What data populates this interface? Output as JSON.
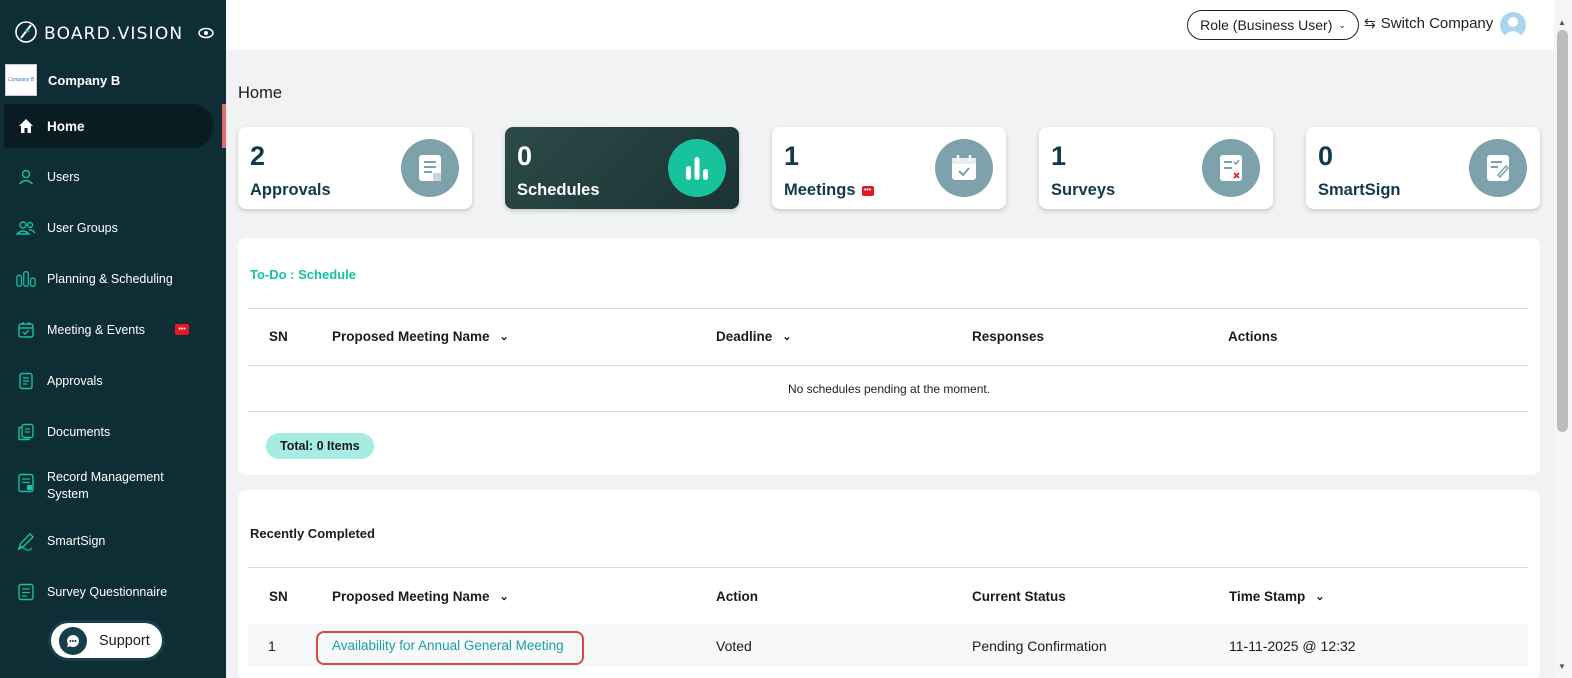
{
  "brand": {
    "name": "BOARD.VISION"
  },
  "company": {
    "name": "Company B",
    "logo_text": "Company B"
  },
  "sidebar": {
    "items": [
      {
        "label": "Home",
        "icon": "home-icon",
        "active": true
      },
      {
        "label": "Users",
        "icon": "user-icon"
      },
      {
        "label": "User Groups",
        "icon": "user-groups-icon"
      },
      {
        "label": "Planning & Scheduling",
        "icon": "planning-icon"
      },
      {
        "label": "Meeting & Events",
        "icon": "calendar-check-icon",
        "badge": "chat"
      },
      {
        "label": "Approvals",
        "icon": "approvals-icon"
      },
      {
        "label": "Documents",
        "icon": "documents-icon"
      },
      {
        "label": "Record Management",
        "label2": "System",
        "icon": "record-icon"
      },
      {
        "label": "SmartSign",
        "icon": "smartsign-icon"
      },
      {
        "label": "Survey Questionnaire",
        "icon": "survey-icon"
      }
    ],
    "support_label": "Support"
  },
  "topbar": {
    "role_label": "Role (Business User)",
    "switch_label": "Switch Company"
  },
  "page": {
    "title": "Home"
  },
  "cards": [
    {
      "count": "2",
      "label": "Approvals",
      "icon": "approvals-doc-icon"
    },
    {
      "count": "0",
      "label": "Schedules",
      "icon": "bar-chart-icon",
      "active": true
    },
    {
      "count": "1",
      "label": "Meetings",
      "icon": "calendar-icon",
      "badge": true
    },
    {
      "count": "1",
      "label": "Surveys",
      "icon": "survey-doc-icon"
    },
    {
      "count": "0",
      "label": "SmartSign",
      "icon": "sign-doc-icon"
    }
  ],
  "todo": {
    "title": "To-Do : Schedule",
    "columns": [
      "SN",
      "Proposed Meeting Name",
      "Deadline",
      "Responses",
      "Actions"
    ],
    "empty_message": "No schedules pending at the moment.",
    "total_label": "Total: 0 Items"
  },
  "recent": {
    "title": "Recently Completed",
    "columns": [
      "SN",
      "Proposed Meeting Name",
      "Action",
      "Current Status",
      "Time Stamp"
    ],
    "rows": [
      {
        "sn": "1",
        "name": "Availability for Annual General Meeting",
        "action": "Voted",
        "status": "Pending Confirmation",
        "timestamp": "11-11-2025 @ 12:32"
      }
    ]
  },
  "colors": {
    "sidebar": "#0f2d35",
    "accent": "#17c29c",
    "link": "#1aa0a0",
    "highlight": "#d84a3c",
    "alert": "#e01b24"
  }
}
